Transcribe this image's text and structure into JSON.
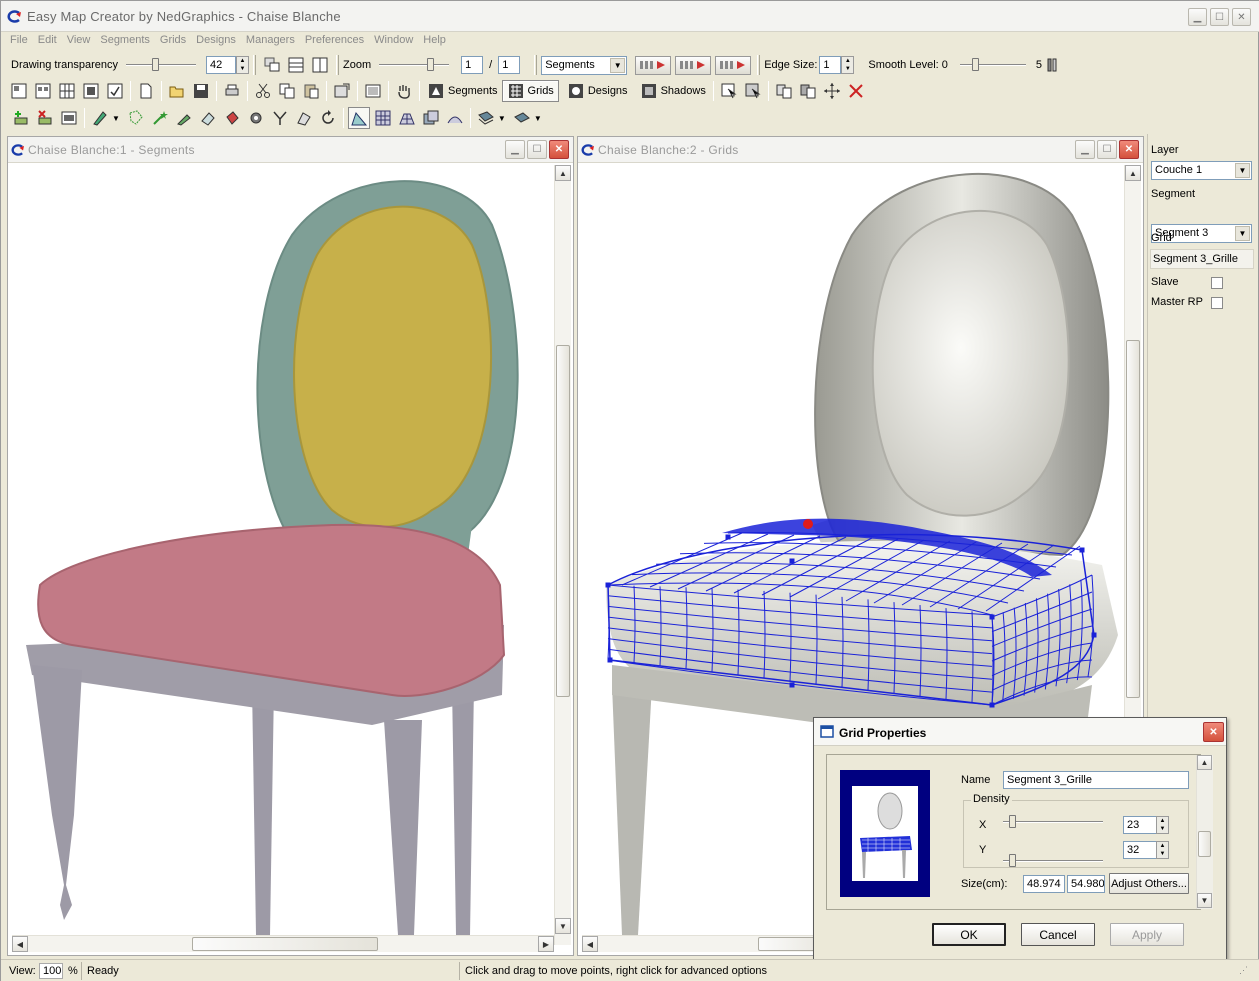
{
  "app": {
    "title": "Easy Map Creator by NedGraphics - Chaise Blanche"
  },
  "menu": [
    "File",
    "Edit",
    "View",
    "Segments",
    "Grids",
    "Designs",
    "Managers",
    "Preferences",
    "Window",
    "Help"
  ],
  "toolbar1": {
    "transparency_label": "Drawing transparency",
    "transparency_value": "42",
    "transparency_level": 0.42,
    "zoom_label": "Zoom",
    "page_current": "1",
    "page_separator": "/",
    "page_total": "1",
    "mode_select": "Segments",
    "edge_size_label": "Edge Size:",
    "edge_size_value": "1",
    "smooth_level_label": "Smooth Level: 0",
    "smooth_max": "5"
  },
  "toolbar2": {
    "segments_label": "Segments",
    "grids_label": "Grids",
    "designs_label": "Designs",
    "shadows_label": "Shadows"
  },
  "windows": {
    "left_title": "Chaise Blanche:1 - Segments",
    "right_title": "Chaise Blanche:2 - Grids"
  },
  "panel": {
    "layer_label": "Layer",
    "layer_value": "Couche 1",
    "segment_label": "Segment",
    "segment_value": "Segment 3",
    "grid_label": "Grid",
    "grid_value": "Segment 3_Grille",
    "slave_label": "Slave",
    "master_label": "Master RP"
  },
  "dialog": {
    "title": "Grid Properties",
    "name_label": "Name",
    "name_value": "Segment 3_Grille",
    "density_label": "Density",
    "x_label": "X",
    "x_value": "23",
    "y_label": "Y",
    "y_value": "32",
    "size_label": "Size(cm):",
    "size_w": "48.974",
    "size_h": "54.980",
    "adjust_label": "Adjust Others...",
    "ok_label": "OK",
    "cancel_label": "Cancel",
    "apply_label": "Apply"
  },
  "status": {
    "view_label": "View:",
    "view_value": "100",
    "view_unit": "%",
    "ready": "Ready",
    "hint": "Click and drag to move points, right click for advanced options"
  },
  "colors": {
    "chair_frame_left": "#7f9f96",
    "chair_back_left": "#c7b04a",
    "chair_seat_left": "#c27a86",
    "chair_legs": "#9d9aa6",
    "grid_line": "#1a22d8",
    "dialog_preview_bg": "#000080"
  }
}
